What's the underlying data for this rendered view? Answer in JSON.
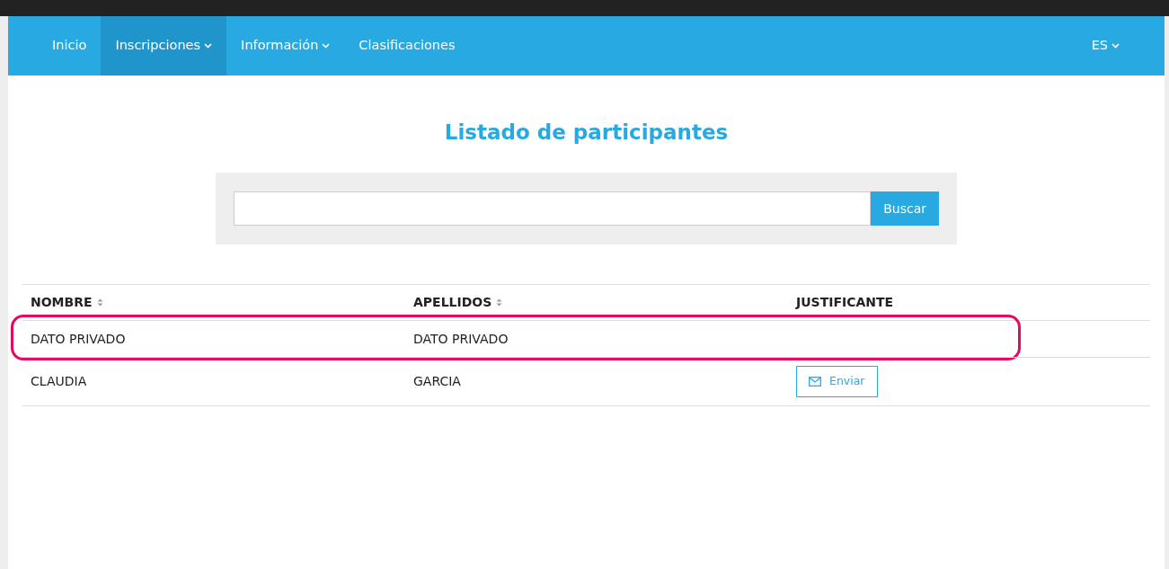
{
  "nav": {
    "items": [
      {
        "label": "Inicio",
        "dropdown": false,
        "selected": false
      },
      {
        "label": "Inscripciones",
        "dropdown": true,
        "selected": true
      },
      {
        "label": "Información",
        "dropdown": true,
        "selected": false
      },
      {
        "label": "Clasificaciones",
        "dropdown": false,
        "selected": false
      }
    ],
    "language": "ES"
  },
  "title": "Listado de participantes",
  "search": {
    "button": "Buscar"
  },
  "table": {
    "columns": [
      {
        "label": "NOMBRE",
        "sortable": true
      },
      {
        "label": "APELLIDOS",
        "sortable": true
      },
      {
        "label": "JUSTIFICANTE",
        "sortable": false
      }
    ],
    "rows": [
      {
        "nombre": "DATO PRIVADO",
        "apellidos": "DATO PRIVADO",
        "action": null,
        "highlighted": true
      },
      {
        "nombre": "CLAUDIA",
        "apellidos": "GARCIA",
        "action": "Enviar",
        "highlighted": false
      }
    ]
  }
}
